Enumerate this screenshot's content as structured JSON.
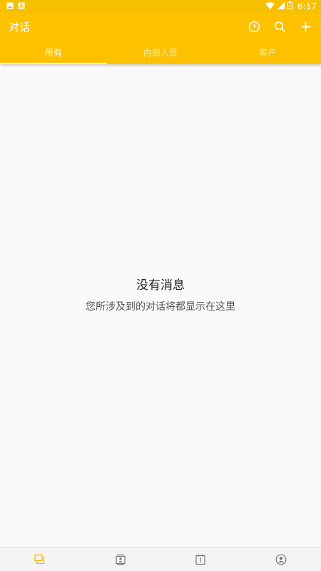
{
  "status_bar": {
    "time": "6:17",
    "left_icons": [
      "image-icon",
      "text-a-icon"
    ],
    "right_icons": [
      "wifi-icon",
      "signal-icon",
      "battery-icon"
    ]
  },
  "app_bar": {
    "title": "对话",
    "actions": [
      "clock-icon",
      "search-icon",
      "add-icon"
    ],
    "background_color": "#fdc100"
  },
  "tabs": [
    {
      "label": "所有",
      "active": true
    },
    {
      "label": "内部人员",
      "active": false
    },
    {
      "label": "客户",
      "active": false
    }
  ],
  "empty_state": {
    "title": "没有消息",
    "subtitle": "您所涉及到的对话将都显示在这里"
  },
  "bottom_nav": {
    "items": [
      {
        "icon": "chat-icon",
        "active": true
      },
      {
        "icon": "contacts-icon",
        "active": false
      },
      {
        "icon": "calendar-icon",
        "active": false
      },
      {
        "icon": "profile-icon",
        "active": false
      }
    ],
    "active_color": "#f5b800",
    "inactive_color": "#777777"
  }
}
